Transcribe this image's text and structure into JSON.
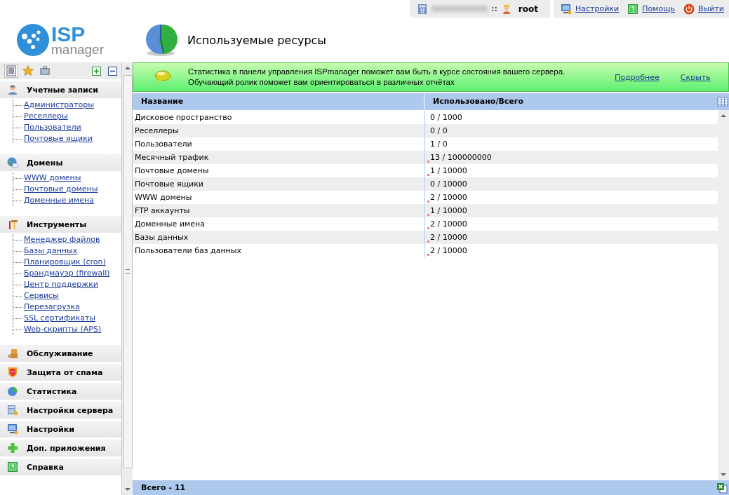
{
  "top_bar": {
    "separator": "::",
    "user": "root",
    "links": [
      {
        "label": "Настройки"
      },
      {
        "label": "Помощь"
      },
      {
        "label": "Выйти"
      }
    ]
  },
  "logo": {
    "top": "ISP",
    "bottom": "manager"
  },
  "page_title": "Используемые ресурсы",
  "sidebar": {
    "tabs": [
      {
        "selected": true
      },
      {
        "selected": false
      },
      {
        "selected": false
      }
    ],
    "sections": [
      {
        "title": "Учетные записи",
        "items": [
          "Администраторы",
          "Реселлеры",
          "Пользователи",
          "Почтовые ящики"
        ]
      },
      {
        "title": "Домены",
        "items": [
          "WWW домены",
          "Почтовые домены",
          "Доменные имена"
        ]
      },
      {
        "title": "Инструменты",
        "items": [
          "Менеджер файлов",
          "Базы данных",
          "Планировщик (cron)",
          "Брандмауэр (firewall)",
          "Центр поддержки",
          "Сервисы",
          "Перезагрузка",
          "SSL сертификаты",
          "Web-скрипты (APS)"
        ]
      },
      {
        "title": "Обслуживание"
      },
      {
        "title": "Защита от спама"
      },
      {
        "title": "Статистика"
      },
      {
        "title": "Настройки сервера"
      },
      {
        "title": "Настройки"
      },
      {
        "title": "Доп. приложения"
      },
      {
        "title": "Справка"
      }
    ]
  },
  "banner": {
    "lines": [
      "Статистика в панели управления ISPmanager поможет вам быть в курсе состояния вашего сервера.",
      "Обучающий ролик поможет вам ориентироваться в различных отчётах"
    ],
    "links": [
      "Подробнее",
      "Скрыть"
    ]
  },
  "table": {
    "columns": [
      "Название",
      "Использовано/Всего"
    ],
    "rows": [
      {
        "name": "Дисковое пространство",
        "usage": "0 / 1000",
        "flagged": false
      },
      {
        "name": "Реселлеры",
        "usage": "0 / 0",
        "flagged": false
      },
      {
        "name": "Пользователи",
        "usage": "1 / 0",
        "flagged": false
      },
      {
        "name": "Месячный трафик",
        "usage": "13 / 100000000",
        "flagged": true
      },
      {
        "name": "Почтовые домены",
        "usage": "1 / 10000",
        "flagged": true
      },
      {
        "name": "Почтовые ящики",
        "usage": "0 / 10000",
        "flagged": false
      },
      {
        "name": "WWW домены",
        "usage": "2 / 10000",
        "flagged": true
      },
      {
        "name": "FTP аккаунты",
        "usage": "1 / 10000",
        "flagged": true
      },
      {
        "name": "Доменные имена",
        "usage": "2 / 10000",
        "flagged": true
      },
      {
        "name": "Базы данных",
        "usage": "2 / 10000",
        "flagged": true
      },
      {
        "name": "Пользователи баз данных",
        "usage": "2 / 10000",
        "flagged": true
      }
    ],
    "footer": "Всего - 11"
  }
}
